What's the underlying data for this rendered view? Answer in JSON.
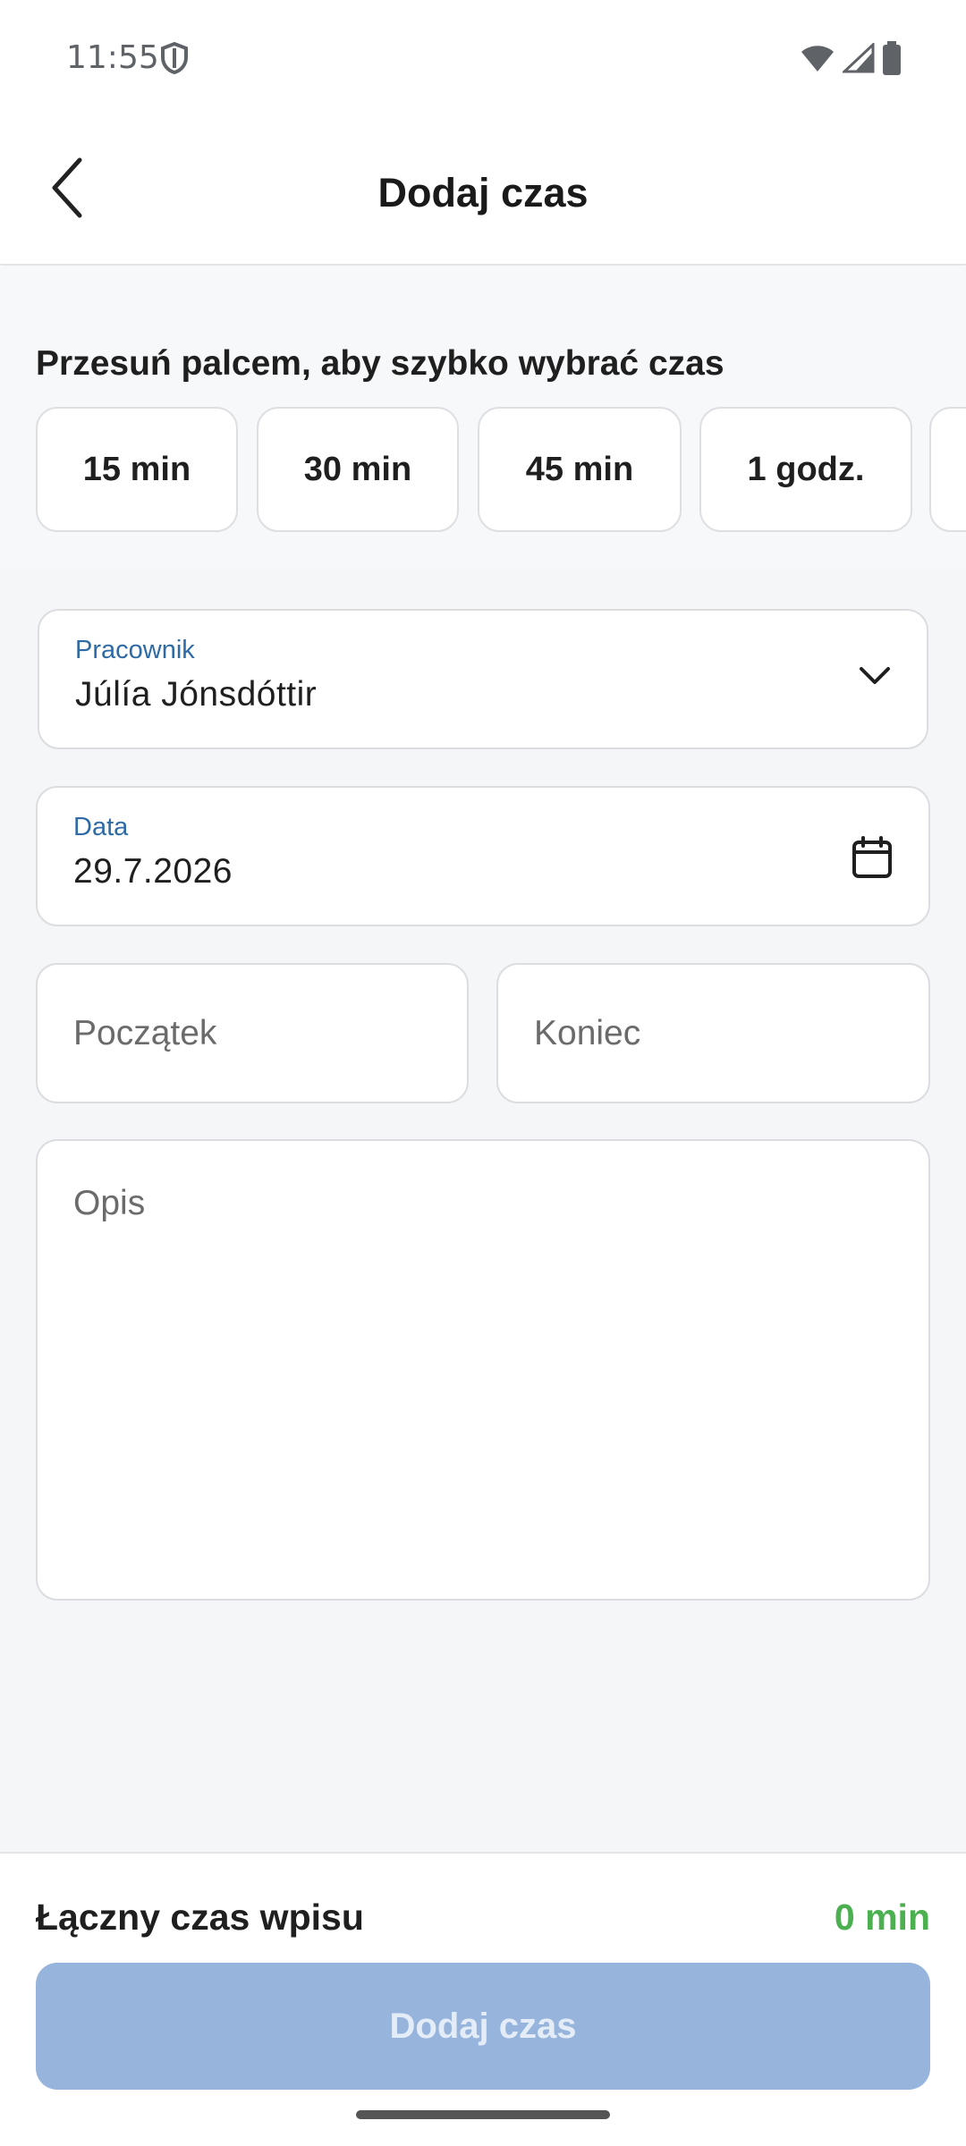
{
  "status_bar": {
    "time": "11:55",
    "icons": [
      "shield-icon",
      "wifi-icon",
      "signal-icon",
      "battery-icon"
    ]
  },
  "app_bar": {
    "title": "Dodaj czas",
    "back_icon": "chevron-left-icon"
  },
  "quick_time": {
    "hint": "Przesuń palcem, aby szybko wybrać czas",
    "chips": [
      "15 min",
      "30 min",
      "45 min",
      "1 godz."
    ]
  },
  "form": {
    "employee": {
      "label": "Pracownik",
      "value": "Júlía Jónsdóttir",
      "icon": "chevron-down-icon"
    },
    "date": {
      "label": "Data",
      "value": "29.7.2026",
      "icon": "calendar-icon"
    },
    "start": {
      "placeholder": "Początek"
    },
    "end": {
      "placeholder": "Koniec"
    },
    "description": {
      "placeholder": "Opis"
    }
  },
  "footer": {
    "total_label": "Łączny czas wpisu",
    "total_value": "0 min",
    "submit_label": "Dodaj czas"
  },
  "colors": {
    "accent_label": "#2d6aa6",
    "total_value": "#4caf50",
    "submit_disabled_bg": "#97b4dc",
    "submit_disabled_text": "#e4ecf7"
  }
}
